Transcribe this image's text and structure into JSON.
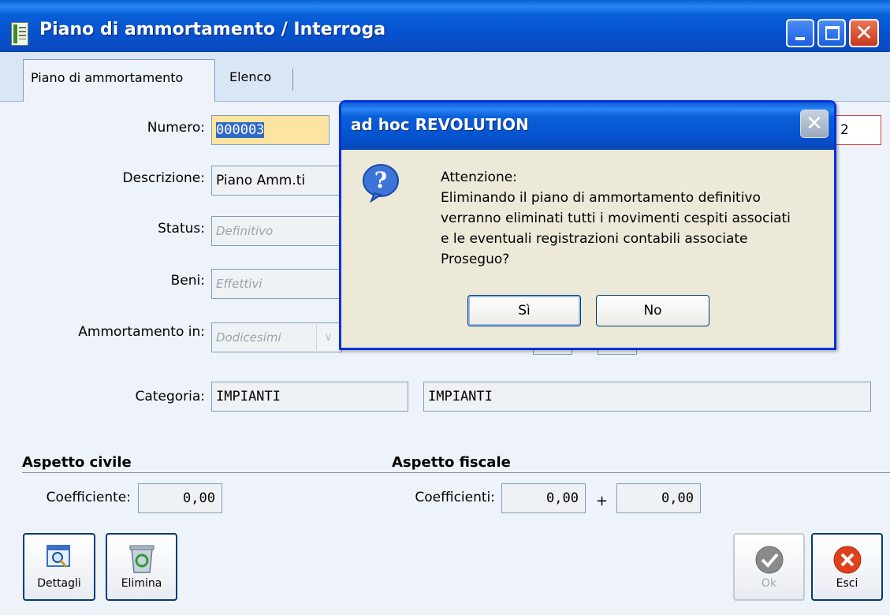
{
  "window": {
    "title": "Piano di ammortamento / Interroga",
    "controls": {
      "minimize": "minimize-icon",
      "maximize": "maximize-icon",
      "close": "✕"
    }
  },
  "tabs": [
    {
      "label": "Piano di ammortamento",
      "active": true
    },
    {
      "label": "Elenco",
      "active": false
    }
  ],
  "form": {
    "numero_label": "Numero:",
    "numero_value": "000003",
    "right_field_value": "2",
    "descrizione_label": "Descrizione:",
    "descrizione_value": "Piano Amm.ti",
    "status_label": "Status:",
    "status_value": "Definitivo",
    "beni_label": "Beni:",
    "beni_value": "Effettivi",
    "ammortamento_label": "Ammortamento in:",
    "ammortamento_value": "Dodicesimi",
    "categoria_label": "Categoria:",
    "categoria_code": "IMPIANTI",
    "categoria_desc": "IMPIANTI"
  },
  "aspetto_civile": {
    "title": "Aspetto civile",
    "coeff_label": "Coefficiente:",
    "coeff_value": "0,00"
  },
  "aspetto_fiscale": {
    "title": "Aspetto fiscale",
    "coeff_label": "Coefficienti:",
    "coeff_value1": "0,00",
    "plus": "+",
    "coeff_value2": "0,00"
  },
  "buttons": {
    "dettagli": "Dettagli",
    "elimina": "Elimina",
    "ok": "Ok",
    "esci": "Esci"
  },
  "dialog": {
    "title": "ad hoc REVOLUTION",
    "close": "✕",
    "icon": "question-icon",
    "message": "Attenzione:\nEliminando il piano di ammortamento definitivo\nverranno eliminati tutti i movimenti cespiti associati\ne le eventuali registrazioni contabili associate\nProseguo?",
    "yes": "Sì",
    "no": "No"
  },
  "colors": {
    "titlebar": "#0a5fd8",
    "highlight_field": "#fde4a0",
    "selection": "#316ac5",
    "dialog_bg": "#ece9d8"
  }
}
